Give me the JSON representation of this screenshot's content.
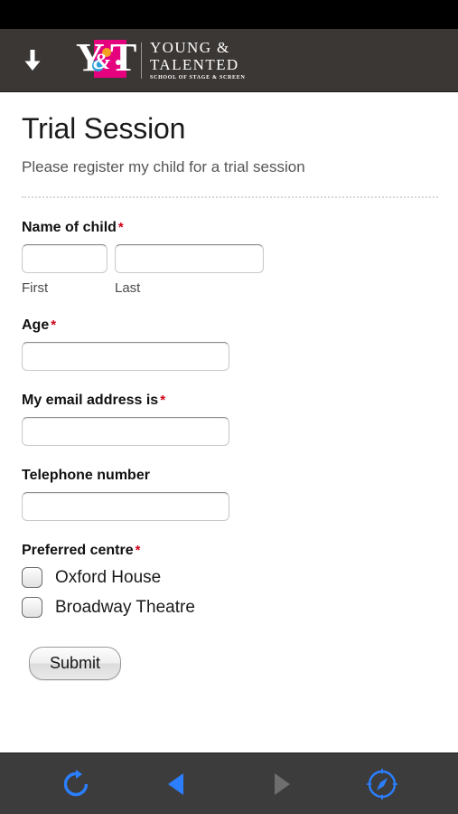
{
  "browser": {
    "status_bar": "",
    "toolbar": {
      "buttons": [
        {
          "name": "reload-icon",
          "label": "Reload",
          "color": "#2b7fff",
          "state": "enabled"
        },
        {
          "name": "back-icon",
          "label": "Back",
          "color": "#2b7fff",
          "state": "enabled"
        },
        {
          "name": "forward-icon",
          "label": "Forward",
          "color": "#6e6e6e",
          "state": "disabled"
        },
        {
          "name": "compass-icon",
          "label": "Explore",
          "color": "#2b7fff",
          "state": "enabled"
        }
      ]
    }
  },
  "header": {
    "menu_icon": "down-arrow-icon",
    "logo": {
      "mark_letters": {
        "y": "Y",
        "t": "T",
        "ampersand": "&"
      },
      "line1": "YOUNG &",
      "line2": "TALENTED",
      "tagline": "SCHOOL OF STAGE & SCREEN",
      "colors": {
        "pink": "#e5007e",
        "blue": "#2e9fd8",
        "orange": "#f6a020",
        "background": "#3a3735"
      }
    }
  },
  "page": {
    "title": "Trial Session",
    "subtitle": "Please register my child for a trial session",
    "required_marker": "*"
  },
  "form": {
    "fields": [
      {
        "id": "name-of-child",
        "label": "Name of child",
        "required": true,
        "type": "name",
        "first": {
          "value": "",
          "placeholder": "",
          "sub_label": "First"
        },
        "last": {
          "value": "",
          "placeholder": "",
          "sub_label": "Last"
        }
      },
      {
        "id": "age",
        "label": "Age",
        "required": true,
        "type": "text",
        "value": "",
        "placeholder": ""
      },
      {
        "id": "email",
        "label": "My email address is",
        "required": true,
        "type": "email",
        "value": "",
        "placeholder": ""
      },
      {
        "id": "telephone",
        "label": "Telephone number",
        "required": false,
        "type": "tel",
        "value": "",
        "placeholder": ""
      },
      {
        "id": "preferred-centre",
        "label": "Preferred centre",
        "required": true,
        "type": "radio",
        "selected": null,
        "options": [
          {
            "id": "oxford-house",
            "label": "Oxford House",
            "checked": false
          },
          {
            "id": "broadway-theatre",
            "label": "Broadway Theatre",
            "checked": false
          }
        ]
      }
    ],
    "submit_label": "Submit"
  }
}
